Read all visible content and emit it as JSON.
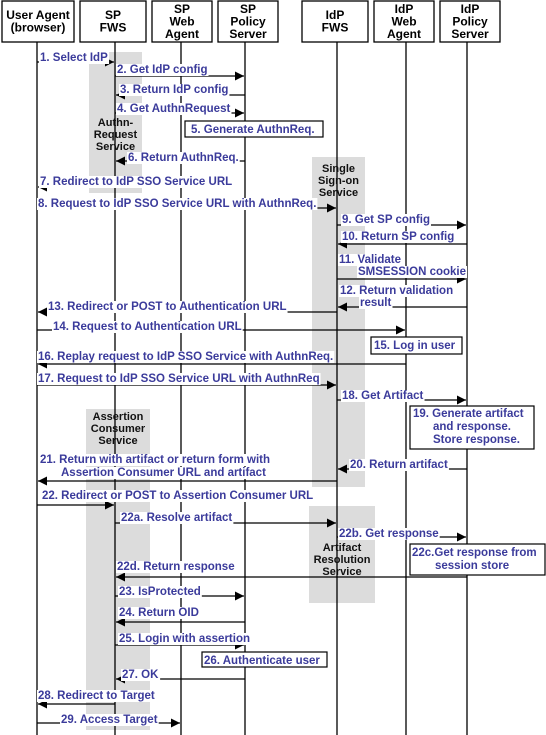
{
  "colors": {
    "label": "#3b3b9b",
    "activation": "#dcdcdc",
    "line": "#000000"
  },
  "participants": [
    {
      "id": "ua",
      "lines": [
        "User Agent",
        "(browser)"
      ]
    },
    {
      "id": "spfws",
      "lines": [
        "SP",
        "FWS"
      ]
    },
    {
      "id": "spwa",
      "lines": [
        "SP",
        "Web",
        "Agent"
      ]
    },
    {
      "id": "spps",
      "lines": [
        "SP",
        "Policy",
        "Server"
      ]
    },
    {
      "id": "idpfws",
      "lines": [
        "IdP",
        "FWS"
      ]
    },
    {
      "id": "idpwa",
      "lines": [
        "IdP",
        "Web",
        "Agent"
      ]
    },
    {
      "id": "idpps",
      "lines": [
        "IdP",
        "Policy",
        "Server"
      ]
    }
  ],
  "services": [
    {
      "lines": [
        "Authn-",
        "Request",
        "Service"
      ]
    },
    {
      "lines": [
        "Single",
        "Sign-on",
        "Service"
      ]
    },
    {
      "lines": [
        "Assertion",
        "Consumer",
        "Service"
      ]
    },
    {
      "lines": [
        "Artifact",
        "Resolution",
        "Service"
      ]
    }
  ],
  "messages": [
    {
      "from": "ua",
      "to": "spfws",
      "lines": [
        "1. Select IdP"
      ]
    },
    {
      "from": "spfws",
      "to": "spps",
      "lines": [
        "2. Get IdP config"
      ]
    },
    {
      "from": "spps",
      "to": "spfws",
      "lines": [
        "3. Return IdP config"
      ]
    },
    {
      "from": "spfws",
      "to": "spps",
      "lines": [
        "4. Get AuthnRequest"
      ]
    },
    {
      "from": "spps",
      "to": "spfws",
      "lines": [
        "6. Return AuthnReq."
      ]
    },
    {
      "from": "spfws",
      "to": "ua",
      "lines": [
        "7. Redirect to IdP SSO Service URL"
      ]
    },
    {
      "from": "ua",
      "to": "idpfws",
      "lines": [
        "8. Request to IdP SSO Service URL with AuthnReq."
      ]
    },
    {
      "from": "idpfws",
      "to": "idpps",
      "lines": [
        "9. Get SP config"
      ]
    },
    {
      "from": "idpps",
      "to": "idpfws",
      "lines": [
        "10. Return SP config"
      ]
    },
    {
      "from": "idpfws",
      "to": "idpps",
      "lines": [
        "11. Validate",
        "SMSESSION cookie"
      ]
    },
    {
      "from": "idpps",
      "to": "idpfws",
      "lines": [
        "12. Return validation",
        "result"
      ]
    },
    {
      "from": "idpfws",
      "to": "ua",
      "lines": [
        "13. Redirect or POST to Authentication URL"
      ]
    },
    {
      "from": "ua",
      "to": "idpwa",
      "lines": [
        "14. Request to Authentication URL"
      ]
    },
    {
      "from": "idpwa",
      "to": "ua",
      "lines": [
        "16. Replay request to IdP SSO Service with AuthnReq."
      ]
    },
    {
      "from": "ua",
      "to": "idpfws",
      "lines": [
        "17. Request to IdP SSO Service URL with AuthnReq"
      ]
    },
    {
      "from": "idpfws",
      "to": "idpps",
      "lines": [
        "18. Get Artifact"
      ]
    },
    {
      "from": "idpps",
      "to": "idpfws",
      "lines": [
        "20. Return artifact"
      ]
    },
    {
      "from": "idpfws",
      "to": "ua",
      "lines": [
        "21. Return with artifact or return form with",
        "Assertion Consumer URL and artifact"
      ]
    },
    {
      "from": "ua",
      "to": "spfws",
      "lines": [
        "22. Redirect or POST to Assertion Consumer URL"
      ]
    },
    {
      "from": "spfws",
      "to": "idpfws",
      "lines": [
        "22a. Resolve artifact"
      ]
    },
    {
      "from": "idpfws",
      "to": "idpps",
      "lines": [
        "22b. Get response"
      ]
    },
    {
      "from": "idpps",
      "to": "spfws",
      "lines": [
        "22d. Return response"
      ]
    },
    {
      "from": "spfws",
      "to": "spps",
      "lines": [
        "23. IsProtected"
      ]
    },
    {
      "from": "spps",
      "to": "spfws",
      "lines": [
        "24. Return OID"
      ]
    },
    {
      "from": "spfws",
      "to": "spps",
      "lines": [
        "25. Login with assertion"
      ]
    },
    {
      "from": "spps",
      "to": "spfws",
      "lines": [
        "27. OK"
      ]
    },
    {
      "from": "spfws",
      "to": "ua",
      "lines": [
        "28. Redirect to Target"
      ]
    },
    {
      "from": "ua",
      "to": "spwa",
      "lines": [
        "29. Access Target"
      ]
    }
  ],
  "notes": [
    {
      "lines": [
        "5. Generate AuthnReq."
      ]
    },
    {
      "lines": [
        "15. Log in user"
      ]
    },
    {
      "lines": [
        "19. Generate artifact",
        "and response.",
        "Store response."
      ]
    },
    {
      "lines": [
        "22c.Get response from",
        "session store"
      ]
    },
    {
      "lines": [
        "26. Authenticate user"
      ]
    }
  ]
}
